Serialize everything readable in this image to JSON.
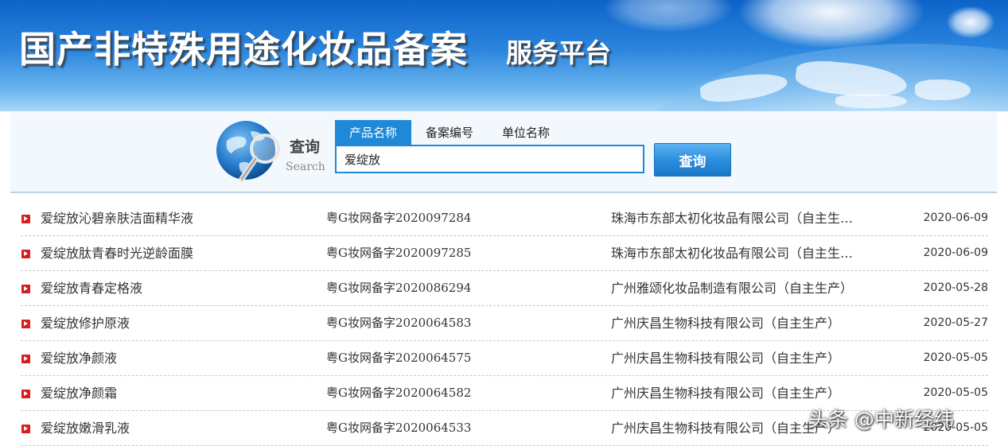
{
  "banner": {
    "title": "国产非特殊用途化妆品备案",
    "subtitle": "服务平台"
  },
  "search": {
    "logo_label": "查询",
    "logo_sub": "Search",
    "tabs": [
      {
        "label": "产品名称",
        "active": true
      },
      {
        "label": "备案编号",
        "active": false
      },
      {
        "label": "单位名称",
        "active": false
      }
    ],
    "input_value": "爱绽放",
    "button_label": "查询"
  },
  "results": [
    {
      "name": "爱绽放沁碧亲肤洁面精华液",
      "code": "粤G妆网备字2020097284",
      "company": "珠海市东部太初化妆品有限公司（自主生…",
      "date": "2020-06-09"
    },
    {
      "name": "爱绽放肽青春时光逆龄面膜",
      "code": "粤G妆网备字2020097285",
      "company": "珠海市东部太初化妆品有限公司（自主生…",
      "date": "2020-06-09"
    },
    {
      "name": "爱绽放青春定格液",
      "code": "粤G妆网备字2020086294",
      "company": "广州雅颂化妆品制造有限公司（自主生产）",
      "date": "2020-05-28"
    },
    {
      "name": "爱绽放修护原液",
      "code": "粤G妆网备字2020064583",
      "company": "广州庆昌生物科技有限公司（自主生产）",
      "date": "2020-05-27"
    },
    {
      "name": "爱绽放净颜液",
      "code": "粤G妆网备字2020064575",
      "company": "广州庆昌生物科技有限公司（自主生产）",
      "date": "2020-05-05"
    },
    {
      "name": "爱绽放净颜霜",
      "code": "粤G妆网备字2020064582",
      "company": "广州庆昌生物科技有限公司（自主生产）",
      "date": "2020-05-05"
    },
    {
      "name": "爱绽放嫩滑乳液",
      "code": "粤G妆网备字2020064533",
      "company": "广州庆昌生物科技有限公司（自主生产）",
      "date": "2020-05-05"
    }
  ],
  "watermark": "头条 @中新经纬",
  "colors": {
    "accent": "#1f89d8",
    "row_icon": "#d71d1d"
  }
}
